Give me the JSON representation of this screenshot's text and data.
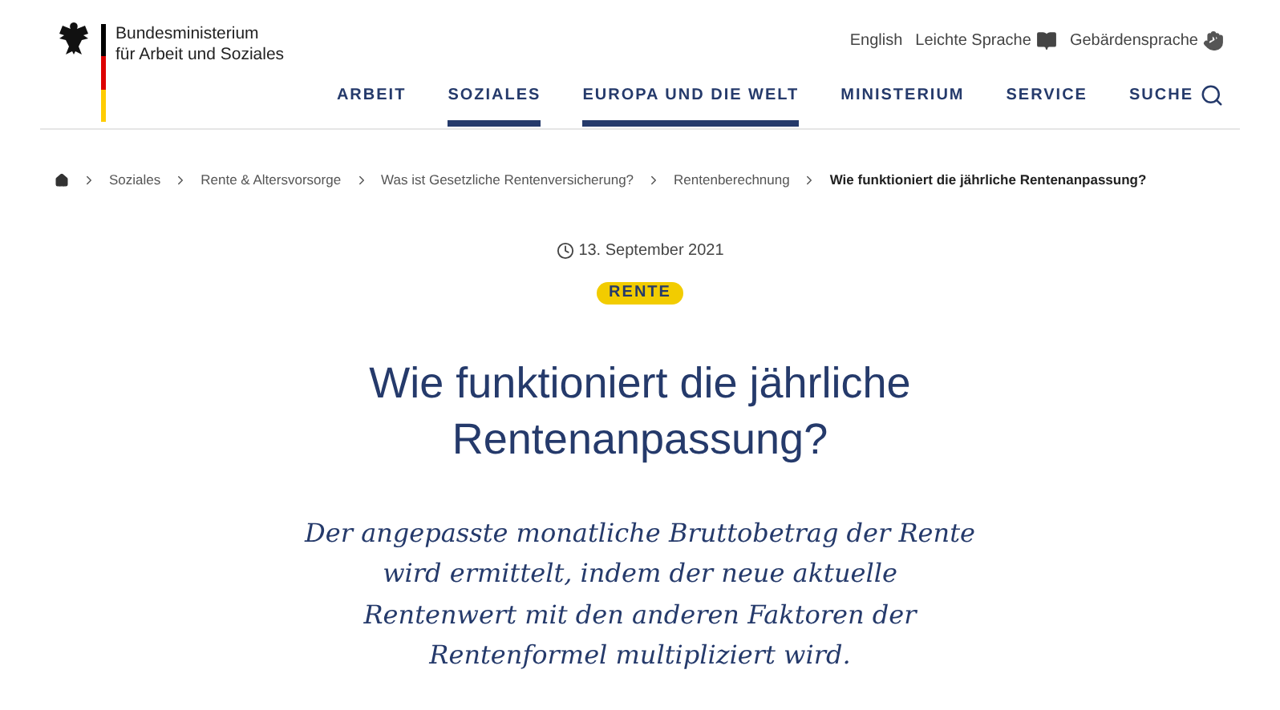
{
  "logo": {
    "line_1": "Bundesministerium",
    "line_2": "für Arbeit und Soziales"
  },
  "service_links": [
    {
      "label": "English"
    },
    {
      "label": "Leichte Sprache"
    },
    {
      "label": "Gebärdensprache"
    }
  ],
  "nav": [
    {
      "label": "ARBEIT",
      "selected": false
    },
    {
      "label": "SOZIALES",
      "selected": true
    },
    {
      "label": "EUROPA UND DIE WELT",
      "selected": true
    },
    {
      "label": "MINISTERIUM",
      "selected": false
    },
    {
      "label": "SERVICE",
      "selected": false
    }
  ],
  "search": {
    "label": "SUCHE"
  },
  "breadcrumb": [
    {
      "label": "Soziales",
      "current": false
    },
    {
      "label": "Rente & Altersvorsorge",
      "current": false
    },
    {
      "label": "Was ist Gesetzliche Rentenversicherung?",
      "current": false
    },
    {
      "label": "Rentenberechnung",
      "current": false
    },
    {
      "label": "Wie funktioniert die jährliche Rentenanpassung?",
      "current": true
    }
  ],
  "article": {
    "date": "13. September 2021",
    "tag": "RENTE",
    "title": "Wie funktioniert die jährliche Rentenanpassung?",
    "teaser": "Der angepasste monatliche Bruttobetrag der Rente wird ermittelt, indem der neue aktuelle Rentenwert mit den anderen Faktoren der Rentenformel multipliziert wird."
  }
}
